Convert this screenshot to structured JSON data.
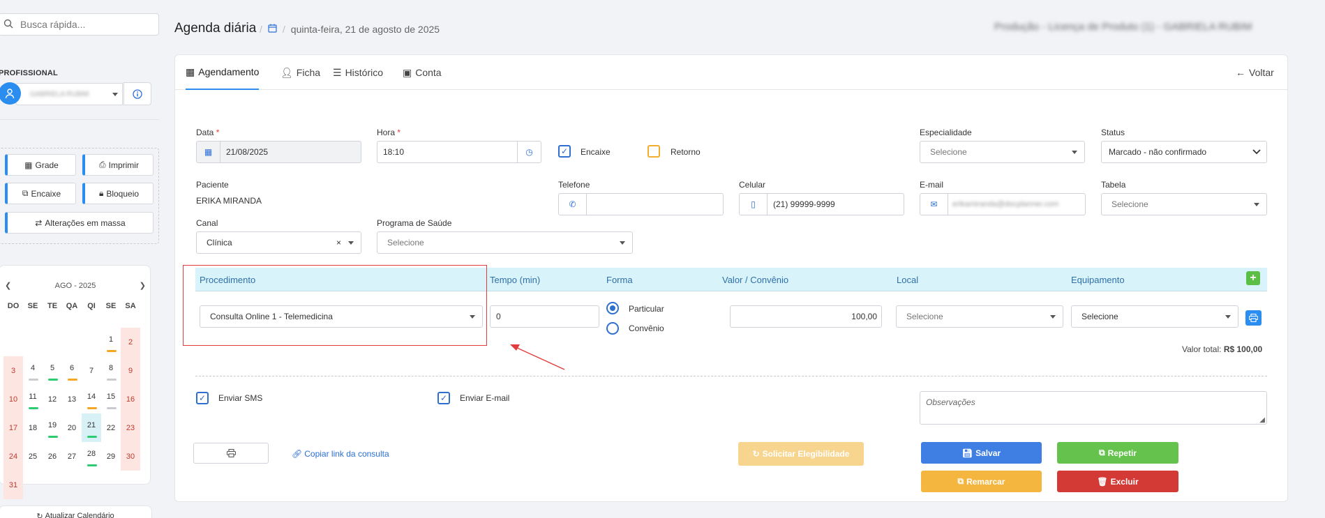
{
  "sidebar": {
    "search_placeholder": "Busca rápida...",
    "profissional_label": "PROFISSIONAL",
    "profissional_value": "GABRIELA RUBIM",
    "buttons": {
      "grade": "Grade",
      "imprimir": "Imprimir",
      "encaixe": "Encaixe",
      "bloqueio": "Bloqueio",
      "alteracoes": "Alterações em massa"
    },
    "calendar": {
      "month": "AGO - 2025",
      "weekdays": [
        "DO",
        "SE",
        "TE",
        "QA",
        "QI",
        "SE",
        "SA"
      ],
      "weeks": [
        [
          "",
          "",
          "",
          "",
          "",
          "1",
          "2"
        ],
        [
          "3",
          "4",
          "5",
          "6",
          "7",
          "8",
          "9"
        ],
        [
          "10",
          "11",
          "12",
          "13",
          "14",
          "15",
          "16"
        ],
        [
          "17",
          "18",
          "19",
          "20",
          "21",
          "22",
          "23"
        ],
        [
          "24",
          "25",
          "26",
          "27",
          "28",
          "29",
          "30"
        ],
        [
          "31",
          "",
          "",
          "",
          "",
          "",
          ""
        ]
      ],
      "today": "21",
      "update_label": "Atualizar Calendário"
    },
    "colors": {
      "green": "#2ecc71",
      "orange": "#f5a623",
      "gray": "#c8cbd0",
      "accent": "#2b8def"
    }
  },
  "header": {
    "title": "Agenda diária",
    "date": "quinta-feira, 21 de agosto de 2025",
    "right_text": "Produção - Licença de Produto (1) - GABRIELA RUBIM"
  },
  "tabs": {
    "agendamento": "Agendamento",
    "ficha": "Ficha",
    "historico": "Histórico",
    "conta": "Conta",
    "voltar": "Voltar"
  },
  "form": {
    "data_label": "Data",
    "data_value": "21/08/2025",
    "hora_label": "Hora",
    "hora_value": "18:10",
    "encaixe_label": "Encaixe",
    "retorno_label": "Retorno",
    "especialidade_label": "Especialidade",
    "especialidade_placeholder": "Selecione",
    "status_label": "Status",
    "status_value": "Marcado - não confirmado",
    "paciente_label": "Paciente",
    "paciente_value": "ERIKA MIRANDA",
    "telefone_label": "Telefone",
    "telefone_value": "",
    "celular_label": "Celular",
    "celular_value": "(21) 99999-9999",
    "email_label": "E-mail",
    "email_value": "erikamiranda@docplanner.com",
    "tabela_label": "Tabela",
    "tabela_placeholder": "Selecione",
    "canal_label": "Canal",
    "canal_value": "Clínica",
    "programa_label": "Programa de Saúde",
    "programa_placeholder": "Selecione"
  },
  "procedure": {
    "headers": {
      "procedimento": "Procedimento",
      "tempo": "Tempo (min)",
      "forma": "Forma",
      "valor": "Valor / Convênio",
      "local": "Local",
      "equipamento": "Equipamento"
    },
    "procedimento_value": "Consulta Online 1 - Telemedicina",
    "tempo_value": "0",
    "particular_label": "Particular",
    "convenio_label": "Convênio",
    "valor_value": "100,00",
    "local_placeholder": "Selecione",
    "equipamento_value": "Selecione",
    "total_label": "Valor total:",
    "total_value": "R$ 100,00"
  },
  "options": {
    "enviar_sms": "Enviar SMS",
    "enviar_email": "Enviar E-mail",
    "observacoes_placeholder": "Observações"
  },
  "actions": {
    "copiar_link": "Copiar link da consulta",
    "solicitar": "Solicitar Elegibilidade",
    "salvar": "Salvar",
    "repetir": "Repetir",
    "remarcar": "Remarcar",
    "excluir": "Excluir"
  },
  "button_colors": {
    "salvar": "#3f7fe3",
    "repetir": "#65c34d",
    "remarcar": "#f4b63f",
    "excluir": "#d33a35",
    "solicitar": "#f7d58f"
  }
}
